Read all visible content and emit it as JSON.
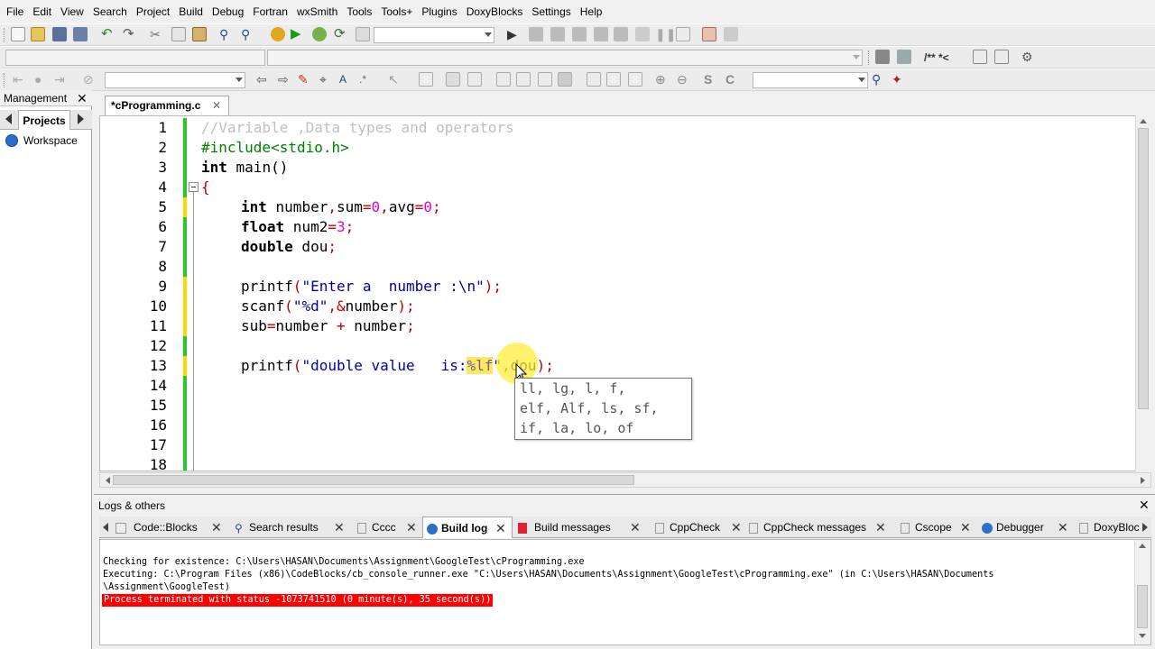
{
  "menubar": {
    "items": [
      "File",
      "Edit",
      "View",
      "Search",
      "Project",
      "Build",
      "Debug",
      "Fortran",
      "wxSmith",
      "Tools",
      "Tools+",
      "Plugins",
      "DoxyBlocks",
      "Settings",
      "Help"
    ]
  },
  "toolbar": {
    "doxy_comment_label": "/** *<"
  },
  "management": {
    "title": "Management",
    "close": "✕",
    "tab_projects": "Projects",
    "workspace_label": "Workspace"
  },
  "editor": {
    "tab_label": "*cProgramming.c",
    "tab_close": "✕",
    "line_numbers": [
      "1",
      "2",
      "3",
      "4",
      "5",
      "6",
      "7",
      "8",
      "9",
      "10",
      "11",
      "12",
      "13",
      "14",
      "15",
      "16",
      "17",
      "18"
    ],
    "lines": {
      "l1": {
        "comment": "//Variable ,Data types and operators"
      },
      "l2": {
        "directive": "#include<stdio.h>"
      },
      "l3": {
        "kw": "int",
        "rest": " main()"
      },
      "l4": {
        "brace": "{"
      },
      "l5": {
        "kw": "int",
        "a": " number",
        "o1": ",",
        "b": "sum",
        "o2": "=",
        "n1": "0",
        "o3": ",",
        "c": "avg",
        "o4": "=",
        "n2": "0",
        "o5": ";"
      },
      "l6": {
        "kw": "float",
        "a": " num2",
        "o1": "=",
        "n1": "3",
        "o2": ";"
      },
      "l7": {
        "kw": "double",
        "a": " dou",
        "o1": ";"
      },
      "l9": {
        "fn": "printf",
        "o1": "(",
        "s": "\"Enter a  number :\\n\"",
        "o2": ");"
      },
      "l10": {
        "fn": "scanf",
        "o1": "(",
        "s": "\"%d\"",
        "o2": ",&",
        "a": "number",
        "o3": ");"
      },
      "l11": {
        "a": "sub",
        "o1": "=",
        "b": "number ",
        "o2": "+",
        "c": " number",
        "o3": ";"
      },
      "l13": {
        "fn": "printf",
        "o1": "(",
        "s1": "\"double value   is:",
        "s2": "%lf",
        "s3": "\"",
        "o2": ",",
        "a": "dou",
        "o3": ");"
      }
    },
    "autocomplete": [
      "ll, lg, l, f,",
      "elf, Alf, ls, sf,",
      "if, la, lo, of"
    ]
  },
  "logs": {
    "title": "Logs & others",
    "close": "✕",
    "tabs": [
      {
        "label": "Code::Blocks",
        "close": "✕"
      },
      {
        "label": "Search results",
        "close": "✕"
      },
      {
        "label": "Cccc",
        "close": "✕"
      },
      {
        "label": "Build log",
        "close": "✕"
      },
      {
        "label": "Build messages",
        "close": "✕"
      },
      {
        "label": "CppCheck",
        "close": "✕"
      },
      {
        "label": "CppCheck messages",
        "close": "✕"
      },
      {
        "label": "Cscope",
        "close": "✕"
      },
      {
        "label": "Debugger",
        "close": "✕"
      },
      {
        "label": "DoxyBloc"
      }
    ],
    "lines": [
      "Checking for existence: C:\\Users\\HASAN\\Documents\\Assignment\\GoogleTest\\cProgramming.exe",
      "Executing: C:\\Program Files (x86)\\CodeBlocks/cb_console_runner.exe \"C:\\Users\\HASAN\\Documents\\Assignment\\GoogleTest\\cProgramming.exe\" (in C:\\Users\\HASAN\\Documents",
      "\\Assignment\\GoogleTest)",
      "Process terminated with status -1073741510 (0 minute(s), 35 second(s))"
    ]
  },
  "colors": {
    "keyword": "#000000",
    "comment": "#c0c0c0",
    "preprocessor": "#008000",
    "string": "#0000a0",
    "operator": "#c00000",
    "number": "#e000e0",
    "error_bg": "#ff0000",
    "changed_marker": "#ffd800",
    "saved_marker": "#22cc22"
  }
}
